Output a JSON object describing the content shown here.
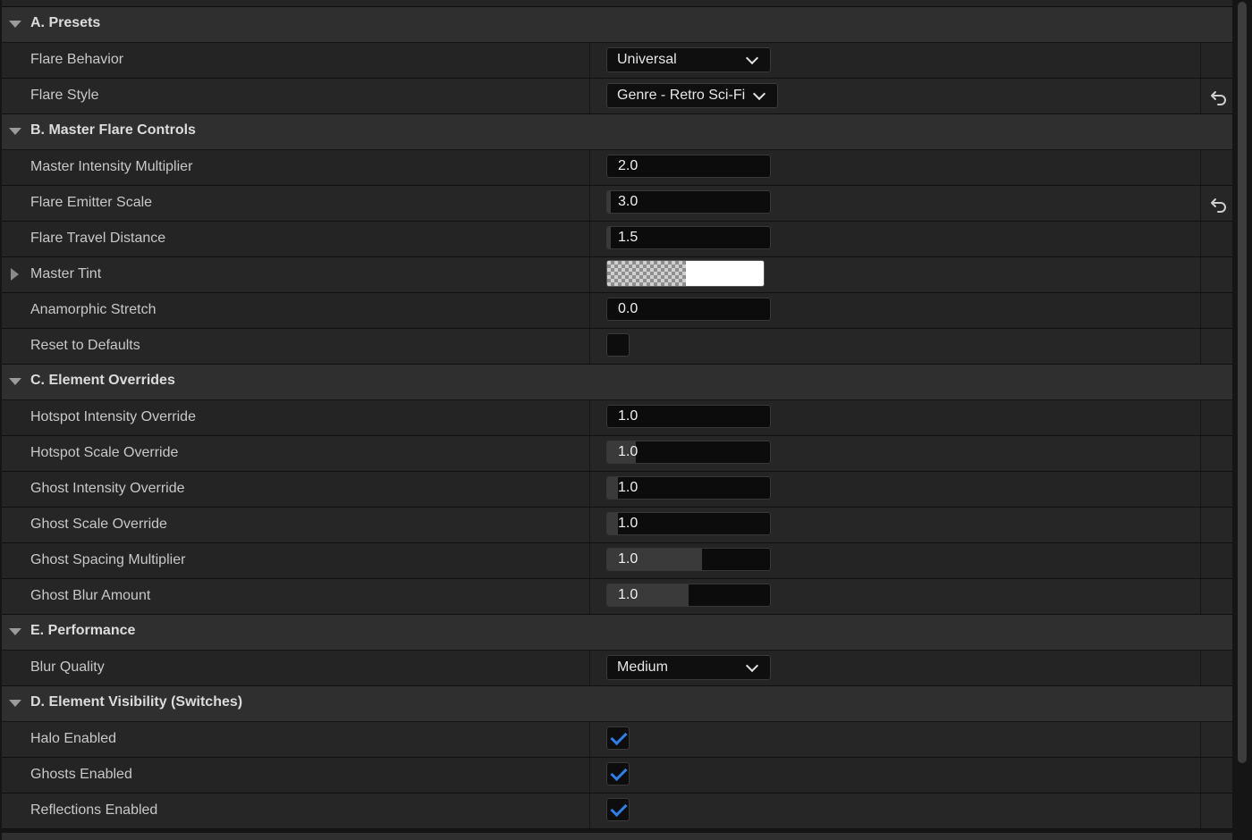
{
  "sections": [
    {
      "title": "A. Presets",
      "rows": [
        {
          "label": "Flare Behavior",
          "type": "dropdown",
          "value": "Universal",
          "reset": false
        },
        {
          "label": "Flare Style",
          "type": "dropdown",
          "value": "Genre - Retro Sci-Fi",
          "reset": true
        }
      ]
    },
    {
      "title": "B. Master Flare Controls",
      "rows": [
        {
          "label": "Master Intensity Multiplier",
          "type": "number",
          "value": "2.0",
          "reset": false
        },
        {
          "label": "Flare Emitter Scale",
          "type": "number",
          "value": "3.0",
          "reset": true
        },
        {
          "label": "Flare Travel Distance",
          "type": "number",
          "value": "1.5",
          "reset": false
        },
        {
          "label": "Master Tint",
          "type": "color",
          "value": "#ffffff",
          "reset": false
        },
        {
          "label": "Anamorphic Stretch",
          "type": "number",
          "value": "0.0",
          "reset": false
        },
        {
          "label": "Reset to Defaults",
          "type": "checkbox",
          "checked": false,
          "reset": false
        }
      ]
    },
    {
      "title": "C. Element Overrides",
      "rows": [
        {
          "label": "Hotspot Intensity Override",
          "type": "number",
          "value": "1.0",
          "reset": false
        },
        {
          "label": "Hotspot Scale Override",
          "type": "number",
          "value": "1.0",
          "reset": false
        },
        {
          "label": "Ghost Intensity Override",
          "type": "number",
          "value": "1.0",
          "reset": false
        },
        {
          "label": "Ghost Scale Override",
          "type": "number",
          "value": "1.0",
          "reset": false
        },
        {
          "label": "Ghost Spacing Multiplier",
          "type": "number",
          "value": "1.0",
          "reset": false
        },
        {
          "label": "Ghost Blur Amount",
          "type": "number",
          "value": "1.0",
          "reset": false
        }
      ]
    },
    {
      "title": "E. Performance",
      "rows": [
        {
          "label": "Blur Quality",
          "type": "dropdown",
          "value": "Medium",
          "reset": false
        }
      ]
    },
    {
      "title": "D. Element Visibility (Switches)",
      "rows": [
        {
          "label": "Halo Enabled",
          "type": "checkbox",
          "checked": true,
          "reset": false
        },
        {
          "label": "Ghosts Enabled",
          "type": "checkbox",
          "checked": true,
          "reset": false
        },
        {
          "label": "Reflections Enabled",
          "type": "checkbox",
          "checked": true,
          "reset": false
        }
      ]
    }
  ],
  "colors": {
    "checkmark": "#2f7fe6",
    "slider_fill": "#3a3a3a"
  },
  "icons": {
    "section_toggle": "caret-down-icon",
    "expander": "caret-right-icon",
    "reset": "reset-to-default-icon",
    "dropdown": "chevron-down-icon",
    "check": "checkmark-icon"
  }
}
